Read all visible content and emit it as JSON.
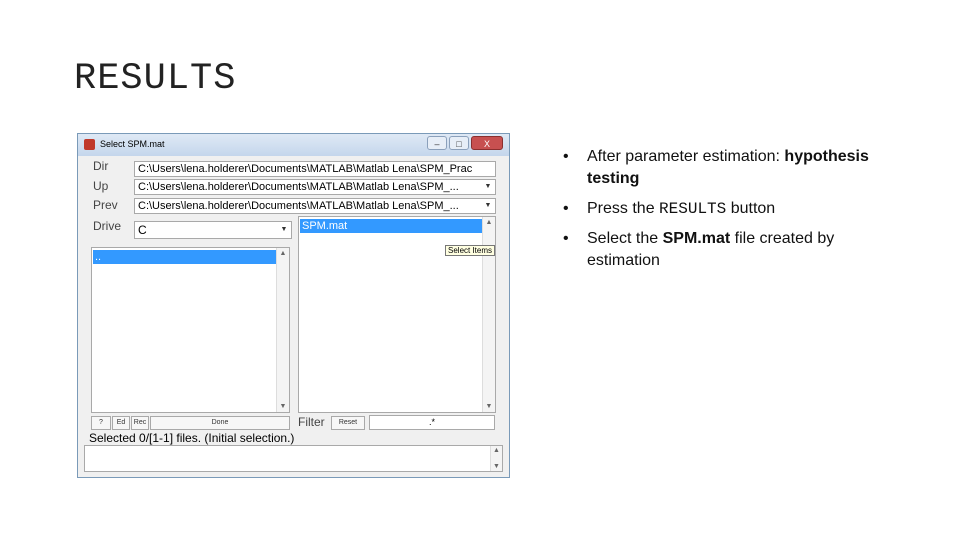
{
  "slide": {
    "title": "RESULTS"
  },
  "window": {
    "title": "Select SPM.mat",
    "controls": {
      "minimize": "–",
      "maximize": "□",
      "close": "X"
    },
    "rows": {
      "dir": {
        "label": "Dir",
        "value": "C:\\Users\\lena.holderer\\Documents\\MATLAB\\Matlab Lena\\SPM_Prac"
      },
      "up": {
        "label": "Up",
        "value": "C:\\Users\\lena.holderer\\Documents\\MATLAB\\Matlab Lena\\SPM_..."
      },
      "prev": {
        "label": "Prev",
        "value": "C:\\Users\\lena.holderer\\Documents\\MATLAB\\Matlab Lena\\SPM_..."
      },
      "drive": {
        "label": "Drive",
        "value": "C"
      }
    },
    "dir_list": {
      "selected": ".."
    },
    "file_list": {
      "selected": "SPM.mat"
    },
    "tooltip": "Select Items",
    "buttons": {
      "help": "?",
      "ed": "Ed",
      "rec": "Rec",
      "done": "Done",
      "reset": "Reset"
    },
    "filter": {
      "label": "Filter",
      "value": ".*"
    },
    "status": "Selected 0/[1-1] files. (Initial selection.)"
  },
  "bullets": [
    {
      "pre": "After parameter estimation: ",
      "bold": "hypothesis testing"
    },
    {
      "pre": "Press the ",
      "mono": "RESULTS",
      "post": " button"
    },
    {
      "pre": "Select the ",
      "bold": "SPM.mat",
      "post": " file created by estimation"
    }
  ],
  "bullet_glyph": "•"
}
